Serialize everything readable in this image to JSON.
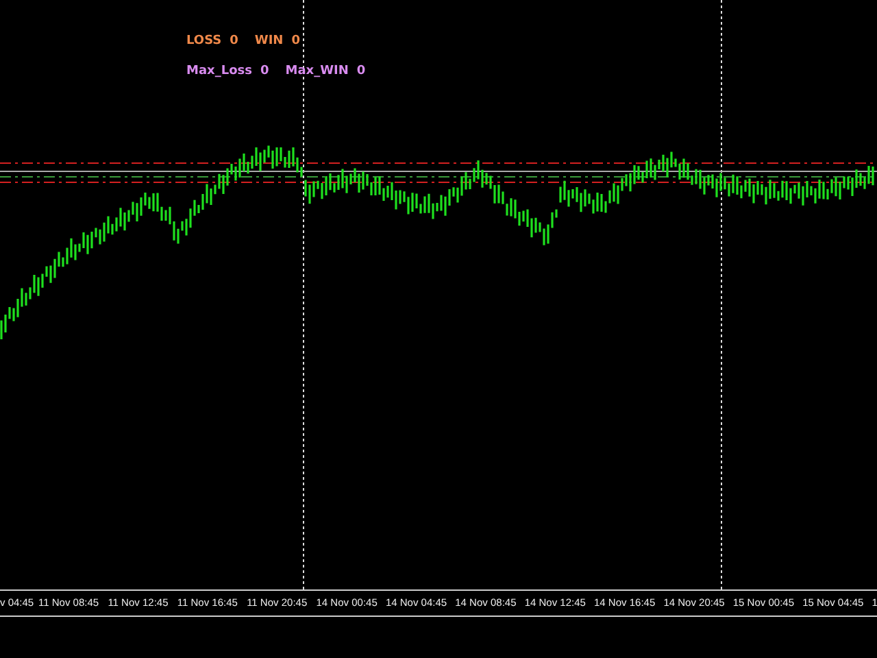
{
  "info_lines": [
    {
      "color": "#f0894a",
      "items": [
        {
          "label": "LOSS",
          "value": "0"
        },
        {
          "label": "WIN",
          "value": "0"
        }
      ]
    },
    {
      "color": "#d98cf0",
      "items": [
        {
          "label": "Max_Loss",
          "value": "0"
        },
        {
          "label": "Max_WIN",
          "value": "0"
        }
      ]
    }
  ],
  "time_axis": {
    "labels": [
      "v 04:45",
      "11 Nov 08:45",
      "11 Nov 12:45",
      "11 Nov 16:45",
      "11 Nov 20:45",
      "14 Nov 00:45",
      "14 Nov 04:45",
      "14 Nov 08:45",
      "14 Nov 12:45",
      "14 Nov 16:45",
      "14 Nov 20:45",
      "15 Nov 00:45",
      "15 Nov 04:45",
      "1"
    ]
  }
}
